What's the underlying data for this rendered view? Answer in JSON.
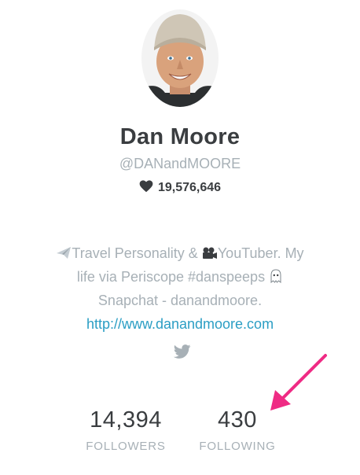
{
  "profile": {
    "name": "Dan Moore",
    "handle": "@DANandMOORE",
    "likes": "19,576,646"
  },
  "bio": {
    "line1_text": "Travel Personality & ",
    "line1_text2": "YouTuber. My",
    "line2_text": "life via Periscope #danspeeps ",
    "line3_text": "Snapchat - danandmoore.",
    "link": "http://www.danandmoore.com"
  },
  "stats": {
    "followers_count": "14,394",
    "followers_label": "FOLLOWERS",
    "following_count": "430",
    "following_label": "FOLLOWING"
  },
  "icons": {
    "heart": "heart-icon",
    "airplane": "airplane-icon",
    "camera": "movie-camera-icon",
    "ghost": "ghost-icon",
    "twitter": "twitter-icon",
    "annotation_arrow": "arrow-icon"
  },
  "colors": {
    "text_dark": "#3a3d40",
    "text_muted": "#a7b0b6",
    "link": "#2b9ec4",
    "annotation_arrow": "#ef2b84"
  }
}
